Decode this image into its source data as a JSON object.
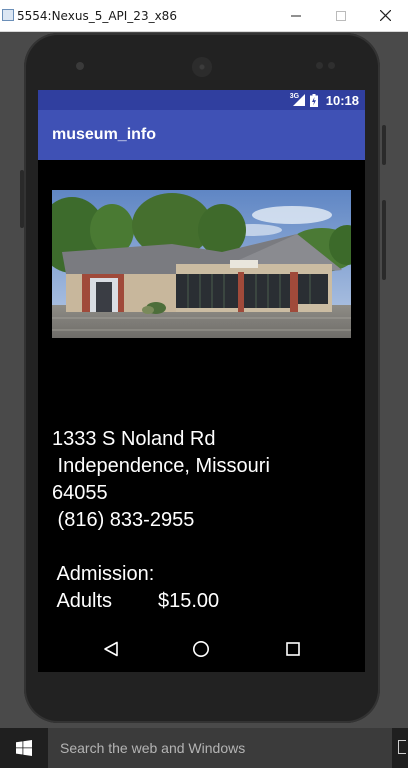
{
  "window": {
    "title": "5554:Nexus_5_API_23_x86",
    "minimize_icon": "minimize-icon",
    "maximize_icon": "maximize-icon",
    "close_icon": "close-icon"
  },
  "status_bar": {
    "network_type": "3G",
    "time": "10:18",
    "color": "#303f9f"
  },
  "app_bar": {
    "title": "museum_info",
    "color": "#3f51b5"
  },
  "museum": {
    "image_icon": "museum-building-photo",
    "address_line1": "1333 S Noland Rd",
    "address_line2": " Independence, Missouri",
    "zip": "64055",
    "phone": " (816) 833-2955",
    "admission_heading": " Admission:",
    "admission_category": " Adults",
    "admission_price": "$15.00"
  },
  "nav_bar": {
    "back_icon": "back-triangle-icon",
    "home_icon": "home-circle-icon",
    "recents_icon": "recents-square-icon"
  },
  "taskbar": {
    "start_icon": "windows-logo-icon",
    "search_placeholder": "Search the web and Windows"
  }
}
